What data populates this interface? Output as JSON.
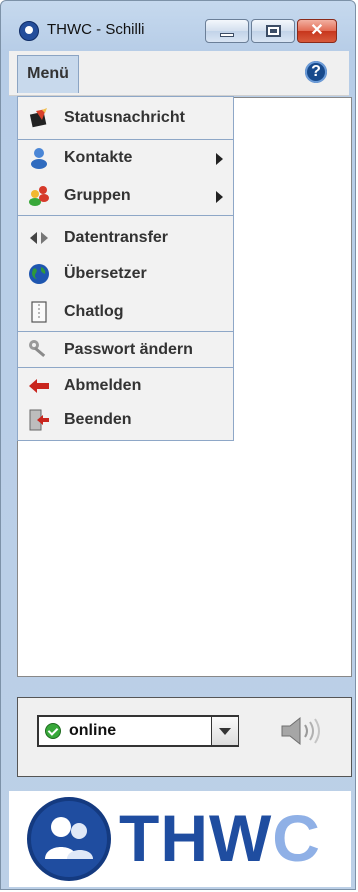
{
  "window": {
    "title": "THWC - Schilli",
    "controls": {
      "minimize_icon": "minimize-icon",
      "maximize_icon": "maximize-icon",
      "close_icon": "close-icon",
      "close_glyph": "✕"
    }
  },
  "menubar": {
    "menu_label": "Menü",
    "help_glyph": "?"
  },
  "menu": {
    "items": [
      {
        "label": "Statusnachricht",
        "icon": "status-message-icon",
        "submenu": false
      },
      {
        "label": "Kontakte",
        "icon": "contacts-icon",
        "submenu": true
      },
      {
        "label": "Gruppen",
        "icon": "groups-icon",
        "submenu": true
      },
      {
        "label": "Datentransfer",
        "icon": "data-transfer-icon",
        "submenu": false
      },
      {
        "label": "Übersetzer",
        "icon": "translator-globe-icon",
        "submenu": false
      },
      {
        "label": "Chatlog",
        "icon": "chatlog-icon",
        "submenu": false
      },
      {
        "label": "Passwort ändern",
        "icon": "keys-icon",
        "submenu": false
      },
      {
        "label": "Abmelden",
        "icon": "logout-arrow-icon",
        "submenu": false
      },
      {
        "label": "Beenden",
        "icon": "exit-door-icon",
        "submenu": false
      }
    ]
  },
  "status": {
    "value": "online",
    "indicator_color": "#38a83a",
    "sound_icon": "speaker-icon"
  },
  "logo": {
    "text_main": "THW",
    "text_accent": "C",
    "brand_color": "#1f4da0",
    "accent_color": "#8fb0e6"
  }
}
